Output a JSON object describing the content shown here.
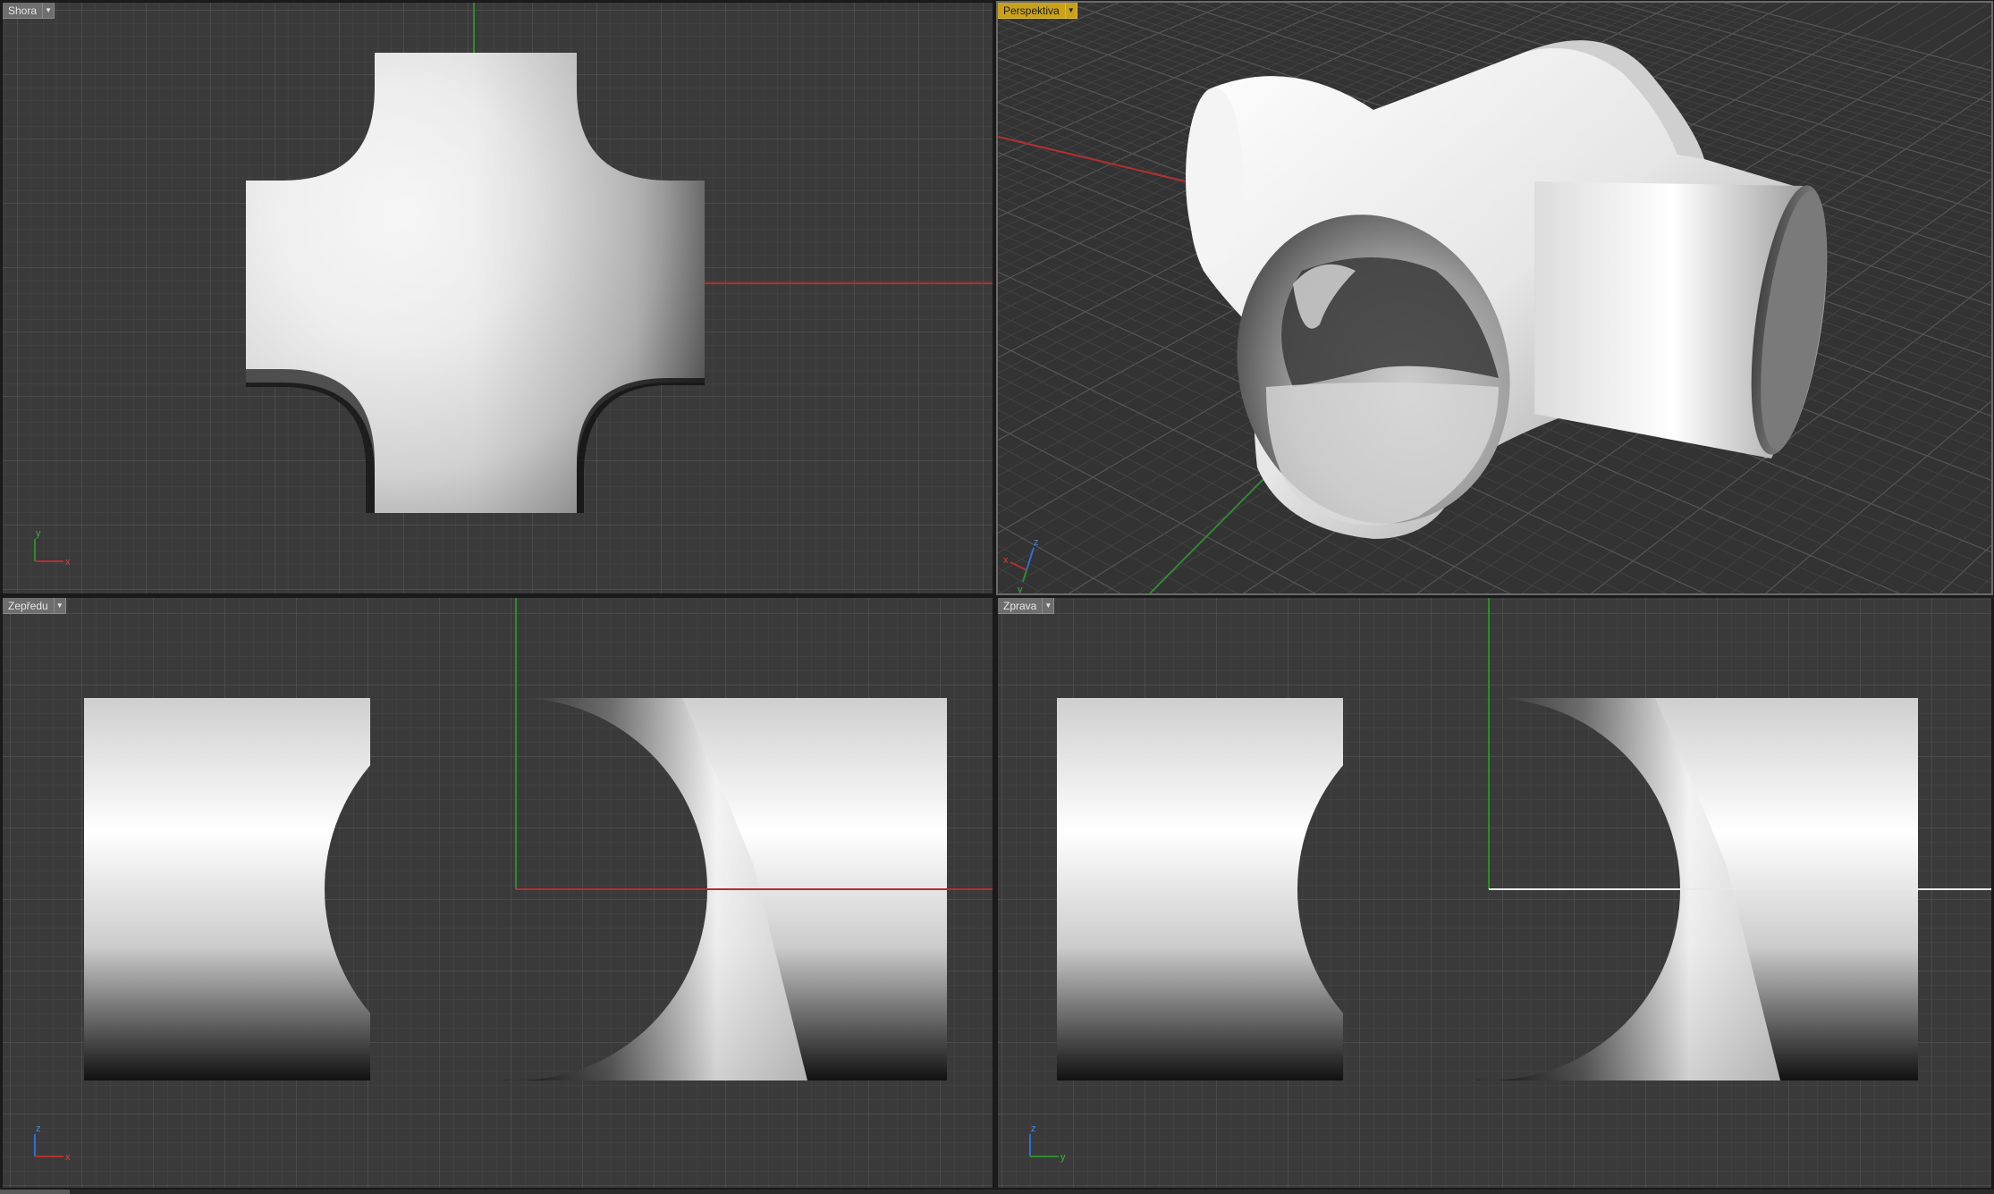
{
  "viewports": {
    "top": {
      "label": "Shora",
      "active": false,
      "axes": [
        "y",
        "x"
      ]
    },
    "perspective": {
      "label": "Perspektiva",
      "active": true,
      "axes": [
        "z",
        "x",
        "y"
      ]
    },
    "front": {
      "label": "Zepředu",
      "active": false,
      "axes": [
        "z",
        "x"
      ]
    },
    "right": {
      "label": "Zprava",
      "active": false,
      "axes": [
        "z",
        "y"
      ]
    }
  },
  "colors": {
    "viewport_bg": "#3a3a3a",
    "grid_minor": "#464646",
    "grid_major": "#525252",
    "axis_x": "#b03030",
    "axis_y": "#2e8b2e",
    "axis_z": "#2f6fd0",
    "active_tab": "#c9a21a",
    "surface_light": "#ffffff",
    "surface_dark": "#000000"
  },
  "icons": {
    "dropdown": "triangle-down-icon",
    "axis_gizmo": "axis-gizmo-icon"
  }
}
